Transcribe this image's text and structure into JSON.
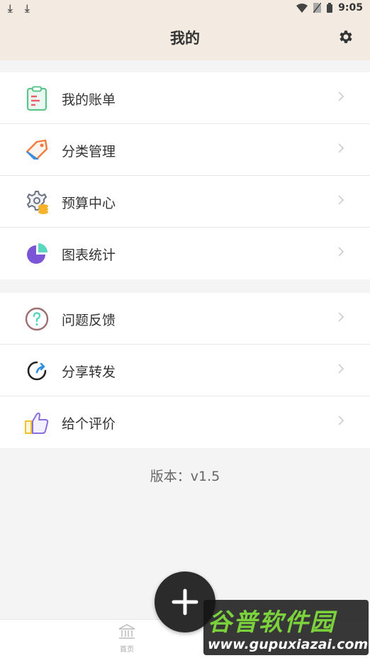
{
  "status_bar": {
    "time": "9:05"
  },
  "header": {
    "title": "我的"
  },
  "groups": [
    {
      "items": [
        {
          "label": "我的账单",
          "icon": "bill-icon"
        },
        {
          "label": "分类管理",
          "icon": "tag-icon"
        },
        {
          "label": "预算中心",
          "icon": "budget-icon"
        },
        {
          "label": "图表统计",
          "icon": "pie-chart-icon"
        }
      ]
    },
    {
      "items": [
        {
          "label": "问题反馈",
          "icon": "question-icon"
        },
        {
          "label": "分享转发",
          "icon": "share-icon"
        },
        {
          "label": "给个评价",
          "icon": "thumbs-up-icon"
        }
      ]
    }
  ],
  "version": "版本：v1.5",
  "bottom_nav": {
    "home_label": "首页"
  },
  "watermark": {
    "title": "谷普软件园",
    "url": "www.gupuxiazai.com"
  },
  "colors": {
    "header_bg": "#f3ebe2",
    "fab_bg": "#2b2b2b",
    "page_bg": "#f4f4f4"
  }
}
